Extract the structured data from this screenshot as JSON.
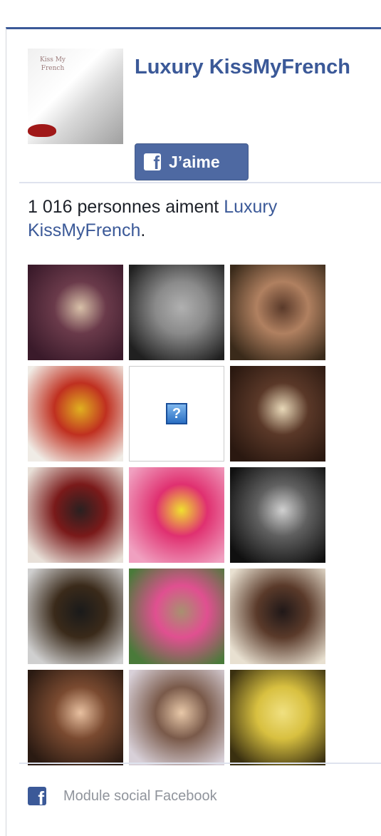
{
  "page": {
    "name": "Luxury KissMyFrench",
    "cover_text": "Kiss My French"
  },
  "like_button": {
    "label": "J’aime"
  },
  "count": {
    "prefix": "1 016 personnes aiment ",
    "page_link": "Luxury KissMyFrench",
    "suffix": "."
  },
  "faces": [
    {
      "type": "photo",
      "colors": [
        "#3a1a2a",
        "#6a3a4a",
        "#d8c0a8"
      ]
    },
    {
      "type": "photo",
      "colors": [
        "#202020",
        "#8a8a8a",
        "#b0b0b0"
      ]
    },
    {
      "type": "photo",
      "colors": [
        "#3a2a1a",
        "#b08060",
        "#5a3a2a"
      ]
    },
    {
      "type": "photo",
      "colors": [
        "#f0ece6",
        "#c03020",
        "#e0b020"
      ]
    },
    {
      "type": "placeholder",
      "glyph": "?"
    },
    {
      "type": "photo",
      "colors": [
        "#2a1810",
        "#5a3828",
        "#e8d8b8"
      ]
    },
    {
      "type": "photo",
      "colors": [
        "#e8e0d8",
        "#7a1a1a",
        "#2a2020"
      ]
    },
    {
      "type": "photo",
      "colors": [
        "#f0a0c0",
        "#e03070",
        "#f0e030"
      ]
    },
    {
      "type": "photo",
      "colors": [
        "#101010",
        "#606060",
        "#d0d0d0"
      ]
    },
    {
      "type": "photo",
      "colors": [
        "#cfcfcf",
        "#3a2a1a",
        "#1a1a1a"
      ]
    },
    {
      "type": "photo",
      "colors": [
        "#4a7a3a",
        "#e05090",
        "#a89070"
      ]
    },
    {
      "type": "photo",
      "colors": [
        "#e8e0d0",
        "#5a3a2a",
        "#201818"
      ]
    },
    {
      "type": "photo",
      "colors": [
        "#2a1a12",
        "#7a4a30",
        "#e8c0a0"
      ]
    },
    {
      "type": "photo",
      "colors": [
        "#d8d0d8",
        "#7a5a4a",
        "#e8c8a8"
      ]
    },
    {
      "type": "photo",
      "colors": [
        "#3a3010",
        "#d8c040",
        "#f0e080"
      ]
    }
  ],
  "footer": {
    "label": "Module social Facebook",
    "icon": "facebook-icon"
  },
  "colors": {
    "brand": "#3b5998",
    "button": "#4e69a2"
  }
}
